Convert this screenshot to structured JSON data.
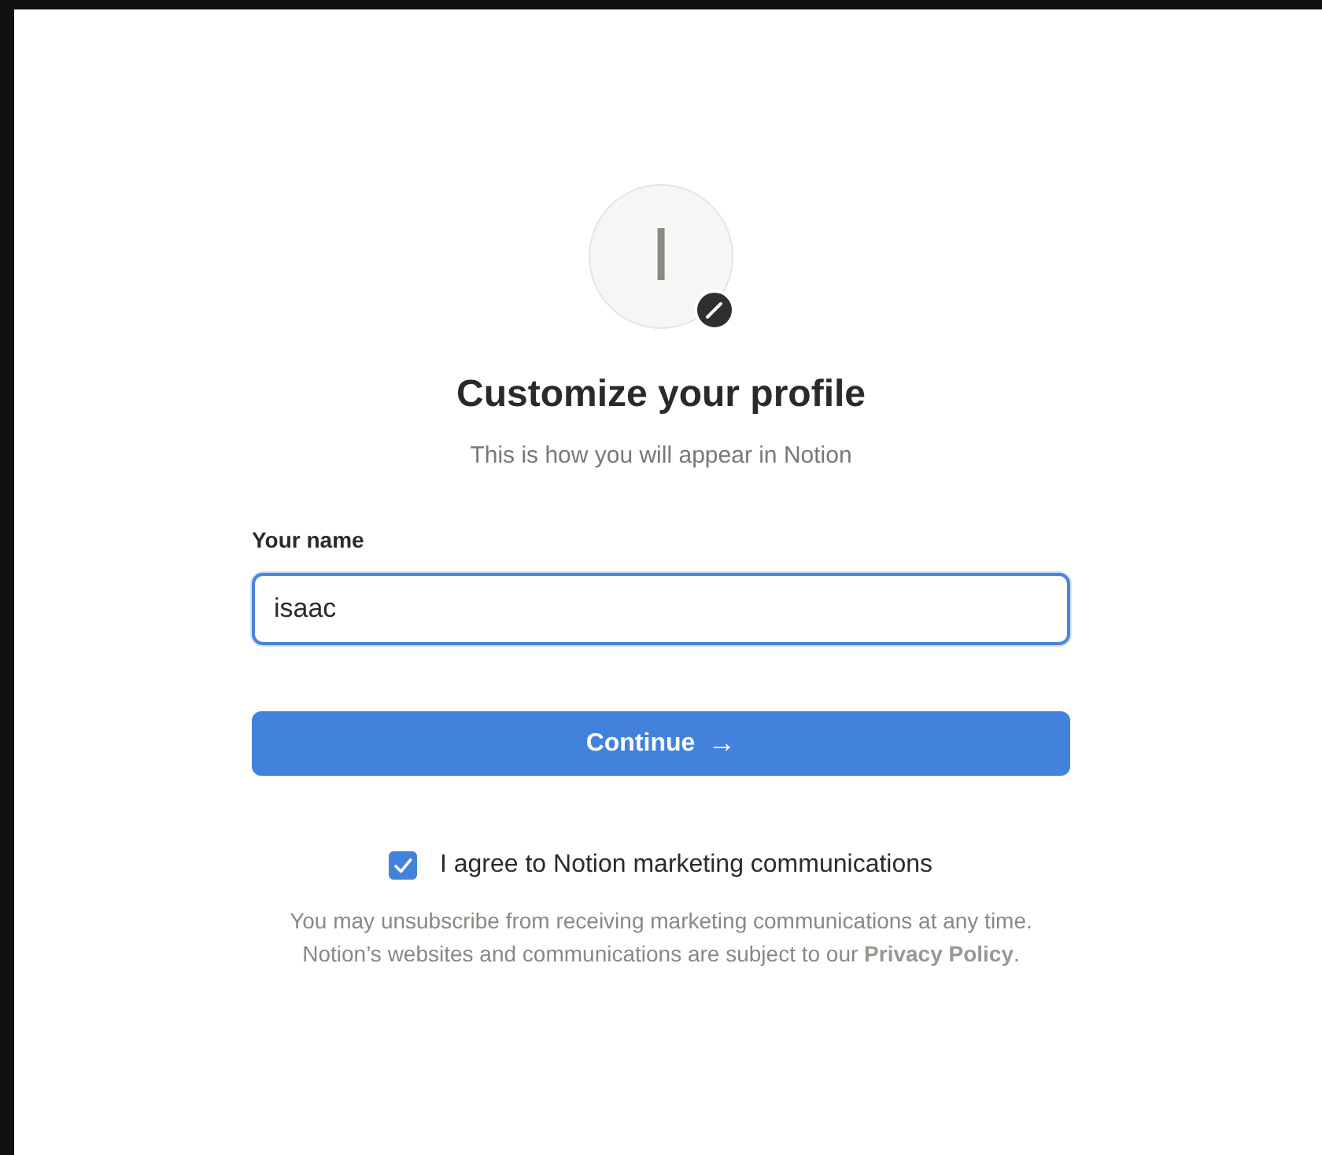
{
  "avatar": {
    "initial": "I"
  },
  "title": "Customize your profile",
  "subtitle": "This is how you will appear in Notion",
  "name_field": {
    "label": "Your name",
    "value": "isaac"
  },
  "continue_button": {
    "label": "Continue",
    "arrow": "→"
  },
  "marketing_checkbox": {
    "label": "I agree to Notion marketing communications",
    "checked": true
  },
  "disclaimer": {
    "text": "You may unsubscribe from receiving marketing communications at any time. Notion’s websites and communications are subject to our",
    "link": "Privacy Policy",
    "end": "."
  }
}
